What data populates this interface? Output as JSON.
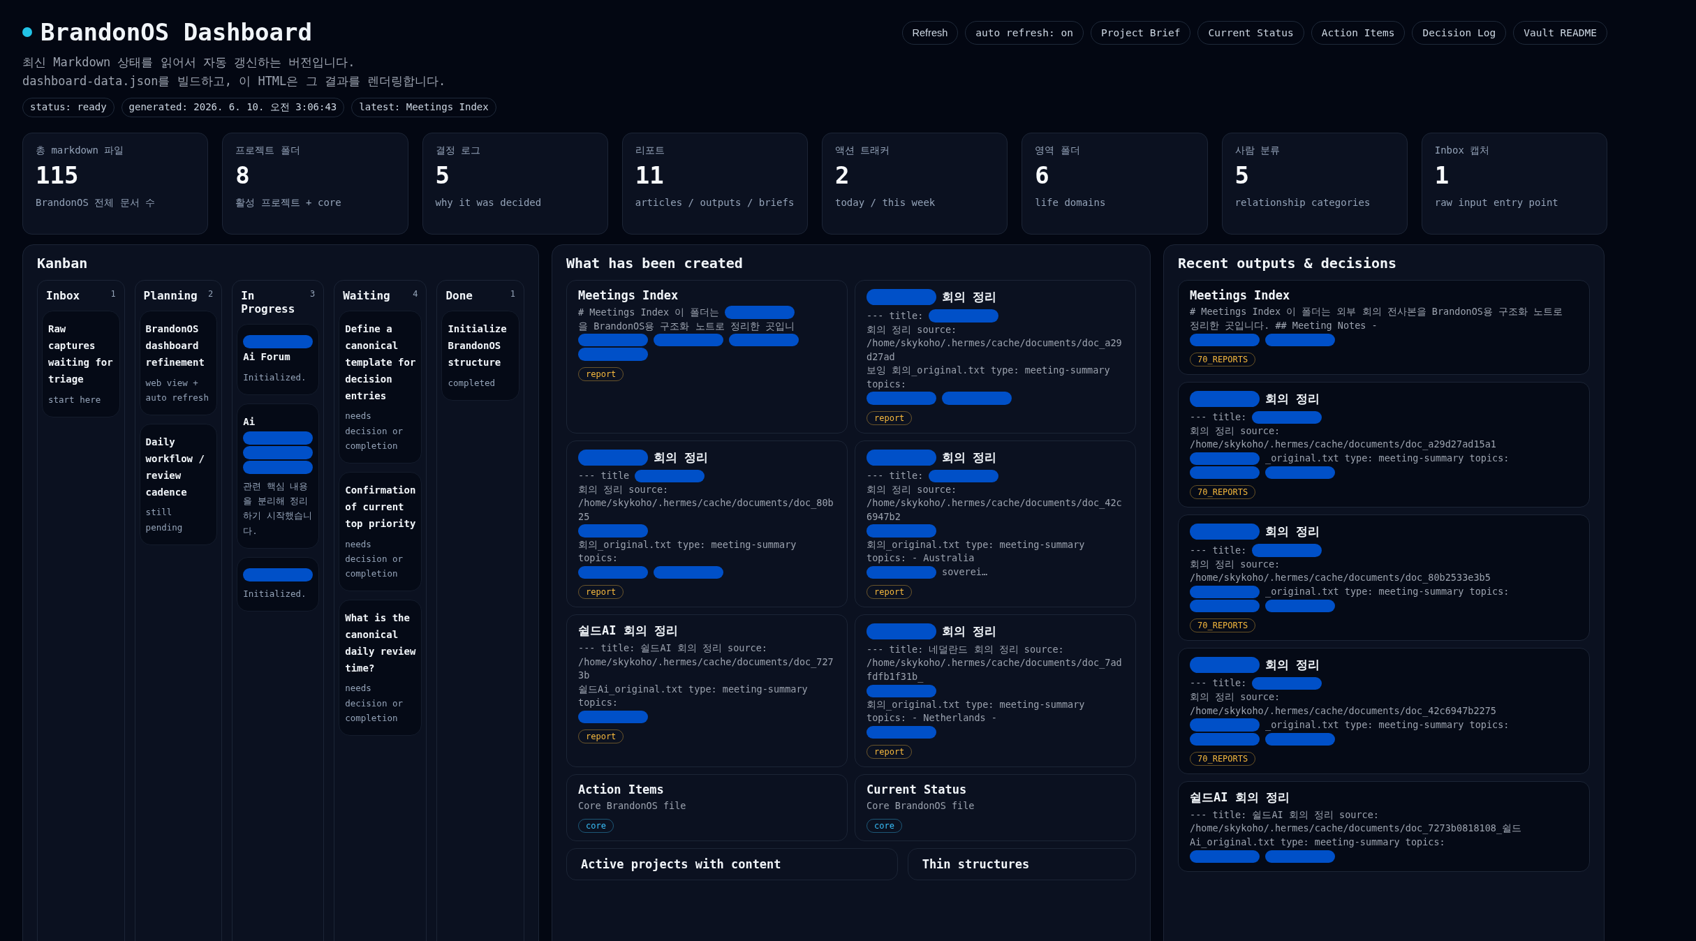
{
  "header": {
    "title": "BrandonOS Dashboard",
    "subtitle": [
      "최신 Markdown 상태를 읽어서 자동 갱신하는 버전입니다.",
      "dashboard-data.json를 빌드하고, 이 HTML은 그 결과를 렌더링합니다."
    ],
    "pills": [
      "status: ready",
      "generated: 2026. 6. 10. 오전 3:06:43",
      "latest: Meetings Index"
    ],
    "buttons": [
      {
        "label": "Refresh",
        "kind": "action"
      },
      {
        "label": "auto refresh: on",
        "kind": "link"
      },
      {
        "label": "Project Brief",
        "kind": "link"
      },
      {
        "label": "Current Status",
        "kind": "link"
      },
      {
        "label": "Action Items",
        "kind": "link"
      },
      {
        "label": "Decision Log",
        "kind": "link"
      },
      {
        "label": "Vault README",
        "kind": "link"
      }
    ]
  },
  "stats": [
    {
      "label": "총 markdown 파일",
      "value": "115",
      "note": "BrandonOS 전체 문서 수"
    },
    {
      "label": "프로젝트 폴더",
      "value": "8",
      "note": "활성 프로젝트 + core"
    },
    {
      "label": "결정 로그",
      "value": "5",
      "note": "why it was decided"
    },
    {
      "label": "리포트",
      "value": "11",
      "note": "articles / outputs / briefs"
    },
    {
      "label": "액션 트래커",
      "value": "2",
      "note": "today / this week"
    },
    {
      "label": "영역 폴더",
      "value": "6",
      "note": "life domains"
    },
    {
      "label": "사람 분류",
      "value": "5",
      "note": "relationship categories"
    },
    {
      "label": "Inbox 캡처",
      "value": "1",
      "note": "raw input entry point"
    }
  ],
  "kanban": {
    "title": "Kanban",
    "columns": [
      {
        "name": "Inbox",
        "count": "1",
        "cards": [
          {
            "title": "Raw captures waiting for triage",
            "note": "start here"
          }
        ]
      },
      {
        "name": "Planning",
        "count": "2",
        "cards": [
          {
            "title": "BrandonOS dashboard refinement",
            "note": "web view + auto refresh"
          },
          {
            "title": "Daily workflow / review cadence",
            "note": "still pending"
          }
        ]
      },
      {
        "name": "In Progress",
        "count": "3",
        "cards": [
          {
            "title": [
              {
                "kind": "redaction"
              },
              {
                "kind": "text",
                "text": "Ai Forum"
              }
            ],
            "note": "Initialized."
          },
          {
            "title": [
              {
                "kind": "text",
                "text": "Ai"
              },
              {
                "kind": "redaction"
              },
              {
                "kind": "redaction"
              },
              {
                "kind": "redaction"
              }
            ],
            "note": "관련 핵심 내용을 분리해 정리하기 시작했습니다."
          },
          {
            "title": [
              {
                "kind": "redaction"
              }
            ],
            "note": "Initialized."
          }
        ]
      },
      {
        "name": "Waiting",
        "count": "4",
        "cards": [
          {
            "title": "Define a canonical template for decision entries",
            "note": "needs decision or completion"
          },
          {
            "title": "Confirmation of current top priority",
            "note": "needs decision or completion"
          },
          {
            "title": "What is the canonical daily review time?",
            "note": "needs decision or completion"
          }
        ]
      },
      {
        "name": "Done",
        "count": "1",
        "cards": [
          {
            "title": "Initialize BrandonOS structure",
            "note": "completed"
          }
        ]
      }
    ]
  },
  "created": {
    "title": "What has been created",
    "cards": [
      {
        "title": [
          {
            "kind": "text",
            "text": "Meetings Index"
          }
        ],
        "body": [
          {
            "kind": "text",
            "text": "# Meetings Index 이 폴더는"
          },
          {
            "kind": "redaction"
          },
          {
            "kind": "text",
            "text": "을 BrandonOS용 구조화 노트로 정리한 곳입니"
          },
          {
            "kind": "redaction"
          },
          {
            "kind": "redaction"
          },
          {
            "kind": "redaction"
          },
          {
            "kind": "redaction"
          }
        ],
        "tag": {
          "label": "report",
          "color": "#f5b83d"
        }
      },
      {
        "title": [
          {
            "kind": "redaction"
          },
          {
            "kind": "text",
            "text": "회의 정리"
          }
        ],
        "body": [
          {
            "kind": "text",
            "text": "--- title:"
          },
          {
            "kind": "redaction"
          },
          {
            "kind": "text",
            "text": "회의 정리 source: /home/skykoho/.hermes/cache/documents/doc_a29d27ad"
          },
          {
            "kind": "text",
            "text": "보잉 회의_original.txt type: meeting-summary topics:"
          },
          {
            "kind": "redaction"
          },
          {
            "kind": "redaction"
          }
        ],
        "tag": {
          "label": "report",
          "color": "#f5b83d"
        }
      },
      {
        "title": [
          {
            "kind": "redaction"
          },
          {
            "kind": "text",
            "text": "회의 정리"
          }
        ],
        "body": [
          {
            "kind": "text",
            "text": "--- title"
          },
          {
            "kind": "redaction"
          },
          {
            "kind": "text",
            "text": "회의 정리 source: /home/skykoho/.hermes/cache/documents/doc_80b25"
          },
          {
            "kind": "redaction"
          },
          {
            "kind": "text",
            "text": "회의_original.txt type: meeting-summary topics:"
          },
          {
            "kind": "redaction"
          },
          {
            "kind": "redaction"
          }
        ],
        "tag": {
          "label": "report",
          "color": "#f5b83d"
        }
      },
      {
        "title": [
          {
            "kind": "redaction"
          },
          {
            "kind": "text",
            "text": "회의 정리"
          }
        ],
        "body": [
          {
            "kind": "text",
            "text": "--- title:"
          },
          {
            "kind": "redaction"
          },
          {
            "kind": "text",
            "text": "회의 정리 source: /home/skykoho/.hermes/cache/documents/doc_42c6947b2"
          },
          {
            "kind": "redaction"
          },
          {
            "kind": "text",
            "text": "회의_original.txt type: meeting-summary topics: - Australia"
          },
          {
            "kind": "redaction"
          },
          {
            "kind": "text",
            "text": "soverei…"
          }
        ],
        "tag": {
          "label": "report",
          "color": "#f5b83d"
        }
      },
      {
        "title": [
          {
            "kind": "text",
            "text": "쉴드AI 회의 정리"
          }
        ],
        "body": [
          {
            "kind": "text",
            "text": "--- title: 쉴드AI 회의 정리 source: /home/skykoho/.hermes/cache/documents/doc_7273b"
          },
          {
            "kind": "text",
            "text": "쉴드Ai_original.txt type: meeting-summary topics:"
          },
          {
            "kind": "redaction"
          }
        ],
        "tag": {
          "label": "report",
          "color": "#f5b83d"
        }
      },
      {
        "title": [
          {
            "kind": "redaction"
          },
          {
            "kind": "text",
            "text": "회의 정리"
          }
        ],
        "body": [
          {
            "kind": "text",
            "text": "--- title: 네덜란드 회의 정리 source: /home/skykoho/.hermes/cache/documents/doc_7adfdfb1f31b_"
          },
          {
            "kind": "redaction"
          },
          {
            "kind": "text",
            "text": "회의_original.txt type: meeting-summary topics: - Netherlands -"
          },
          {
            "kind": "redaction"
          }
        ],
        "tag": {
          "label": "report",
          "color": "#f5b83d"
        }
      },
      {
        "title": [
          {
            "kind": "text",
            "text": "Action Items"
          }
        ],
        "body": [
          {
            "kind": "text",
            "text": "Core BrandonOS file"
          }
        ],
        "tag": {
          "label": "core",
          "color": "#38bdf8"
        }
      },
      {
        "title": [
          {
            "kind": "text",
            "text": "Current Status"
          }
        ],
        "body": [
          {
            "kind": "text",
            "text": "Core BrandonOS file"
          }
        ],
        "tag": {
          "label": "core",
          "color": "#38bdf8"
        }
      }
    ],
    "sections": [
      "Active projects with content",
      "Thin structures"
    ]
  },
  "recent": {
    "title": "Recent outputs & decisions",
    "cards": [
      {
        "title": [
          {
            "kind": "text",
            "text": "Meetings Index"
          }
        ],
        "body": [
          {
            "kind": "text",
            "text": "# Meetings Index 이 폴더는 외부 회의 전사본을 BrandonOS용 구조화 노트로 정리한 곳입니다. ## Meeting Notes -"
          },
          {
            "kind": "redaction"
          },
          {
            "kind": "redaction"
          }
        ],
        "tag": {
          "label": "70_REPORTS",
          "color": "#f5b83d"
        }
      },
      {
        "title": [
          {
            "kind": "redaction"
          },
          {
            "kind": "text",
            "text": "회의 정리"
          }
        ],
        "body": [
          {
            "kind": "text",
            "text": "--- title:"
          },
          {
            "kind": "redaction"
          },
          {
            "kind": "text",
            "text": "회의 정리 source: /home/skykoho/.hermes/cache/documents/doc_a29d27ad15a1"
          },
          {
            "kind": "redaction"
          },
          {
            "kind": "text",
            "text": "_original.txt type: meeting-summary topics:"
          },
          {
            "kind": "redaction"
          },
          {
            "kind": "redaction"
          }
        ],
        "tag": {
          "label": "70_REPORTS",
          "color": "#f5b83d"
        }
      },
      {
        "title": [
          {
            "kind": "redaction"
          },
          {
            "kind": "text",
            "text": "회의 정리"
          }
        ],
        "body": [
          {
            "kind": "text",
            "text": "--- title:"
          },
          {
            "kind": "redaction"
          },
          {
            "kind": "text",
            "text": "회의 정리 source: /home/skykoho/.hermes/cache/documents/doc_80b2533e3b5"
          },
          {
            "kind": "redaction"
          },
          {
            "kind": "text",
            "text": "_original.txt type: meeting-summary topics:"
          },
          {
            "kind": "redaction"
          },
          {
            "kind": "redaction"
          }
        ],
        "tag": {
          "label": "70_REPORTS",
          "color": "#f5b83d"
        }
      },
      {
        "title": [
          {
            "kind": "redaction"
          },
          {
            "kind": "text",
            "text": "회의 정리"
          }
        ],
        "body": [
          {
            "kind": "text",
            "text": "--- title:"
          },
          {
            "kind": "redaction"
          },
          {
            "kind": "text",
            "text": "회의 정리 source: /home/skykoho/.hermes/cache/documents/doc_42c6947b2275"
          },
          {
            "kind": "redaction"
          },
          {
            "kind": "text",
            "text": "_original.txt type: meeting-summary topics:"
          },
          {
            "kind": "redaction"
          },
          {
            "kind": "redaction"
          }
        ],
        "tag": {
          "label": "70_REPORTS",
          "color": "#f5b83d"
        }
      },
      {
        "title": [
          {
            "kind": "text",
            "text": "쉴드AI 회의 정리"
          }
        ],
        "body": [
          {
            "kind": "text",
            "text": "--- title: 쉴드AI 회의 정리 source: /home/skykoho/.hermes/cache/documents/doc_7273b0818108_쉴드 Ai_original.txt type: meeting-summary topics:"
          },
          {
            "kind": "redaction"
          },
          {
            "kind": "redaction"
          }
        ]
      }
    ]
  }
}
